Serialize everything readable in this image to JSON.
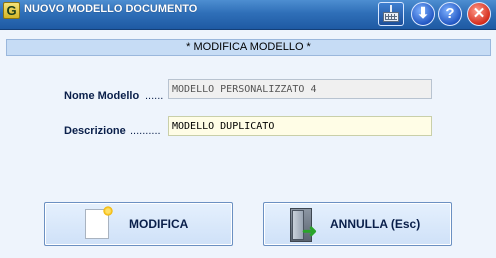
{
  "window": {
    "title": "NUOVO MODELLO DOCUMENTO",
    "app_icon_glyph": "G",
    "controls": {
      "keyboard_icon": "keyboard-icon",
      "download_glyph": "⬇",
      "help_glyph": "?",
      "close_glyph": "✕"
    }
  },
  "section": {
    "title": "* MODIFICA MODELLO *"
  },
  "form": {
    "nome_label": "Nome Modello",
    "nome_dots": "......",
    "nome_value": "MODELLO PERSONALIZZATO 4",
    "descrizione_label": "Descrizione",
    "descrizione_dots": "..........",
    "descrizione_value": "MODELLO DUPLICATO"
  },
  "buttons": {
    "modifica_label": "MODIFICA",
    "annulla_label": "ANNULLA  (Esc)",
    "exit_arrow_glyph": "➜"
  },
  "colors": {
    "titlebar": "#2f6fb8",
    "background": "#eef4fc",
    "section_bar": "#c6dcf5",
    "description_field": "#fffde6"
  }
}
